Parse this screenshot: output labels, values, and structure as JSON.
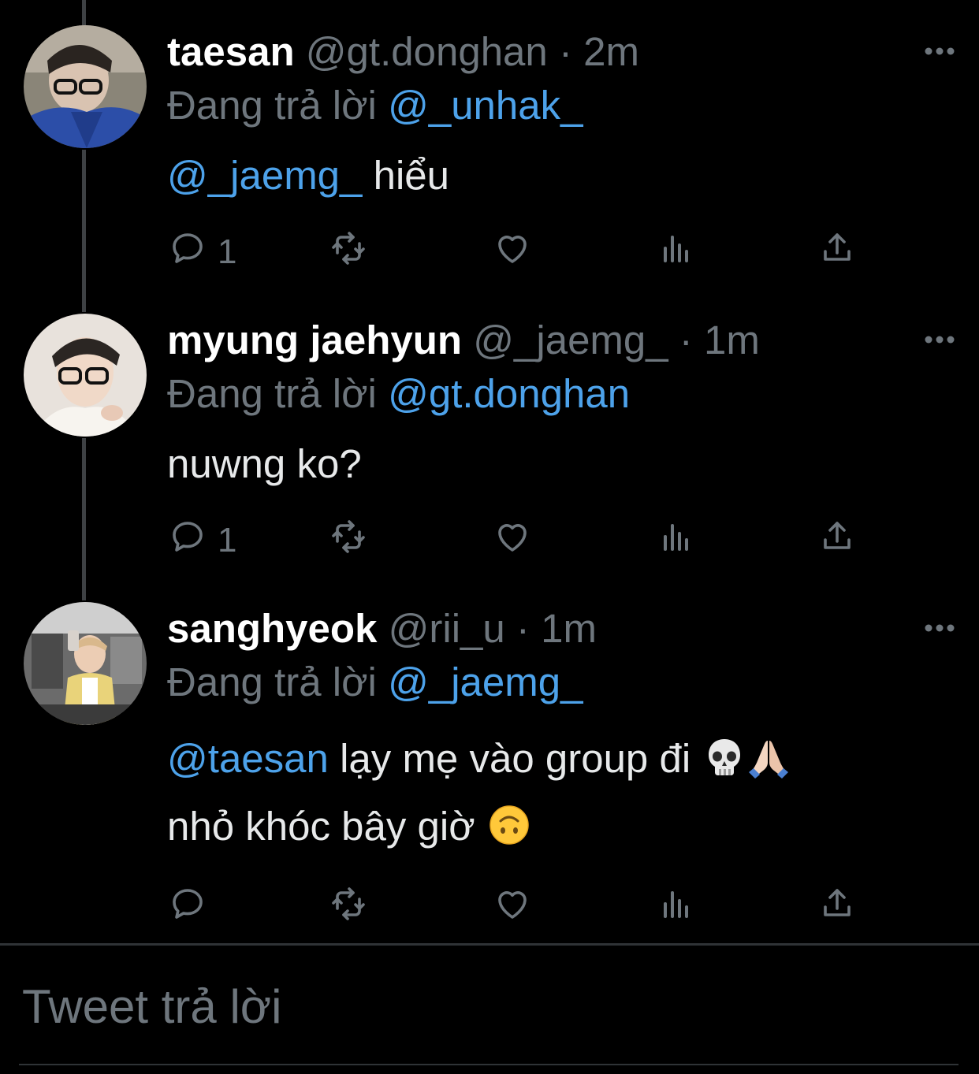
{
  "tweets": [
    {
      "name": "taesan",
      "handle": "@gt.donghan",
      "sep": " · ",
      "time": "2m",
      "replying_prefix": "Đang trả lời ",
      "replying_to": "@_unhak_",
      "body_mention": "@_jaemg_",
      "body_text": " hiểu",
      "reply_count": "1"
    },
    {
      "name": "myung jaehyun",
      "handle": "@_jaemg_",
      "sep": " · ",
      "time": "1m",
      "replying_prefix": "Đang trả lời ",
      "replying_to": "@gt.donghan",
      "body_text": "nuwng ko?",
      "reply_count": "1"
    },
    {
      "name": "sanghyeok",
      "handle": "@rii_u",
      "sep": " · ",
      "time": "1m",
      "replying_prefix": "Đang trả lời ",
      "replying_to": "@_jaemg_",
      "body_mention": "@taesan",
      "body_line1": " lạy mẹ vào group đi ",
      "body_line2": "nhỏ khóc bây giờ ",
      "reply_count": ""
    }
  ],
  "icons": {
    "reply": "reply-icon",
    "retweet": "retweet-icon",
    "like": "heart-icon",
    "views": "views-icon",
    "share": "share-icon",
    "more": "more-icon",
    "emoji_1": "skull-emoji",
    "emoji_2": "folded-hands-emoji",
    "emoji_3": "upside-down-face-emoji"
  },
  "compose": {
    "placeholder": "Tweet trả lời"
  },
  "colors": {
    "background": "#000000",
    "mention": "#4da2ea",
    "muted": "#6e767d",
    "text": "#e7e9ea"
  }
}
